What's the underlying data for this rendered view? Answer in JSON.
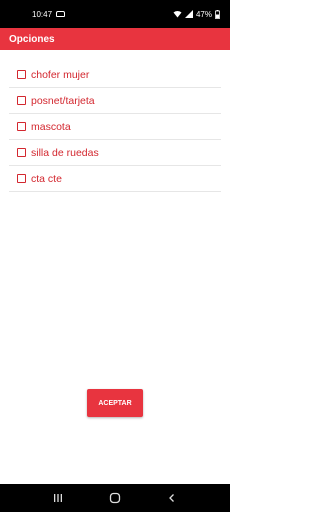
{
  "status_bar": {
    "time": "10:47",
    "battery": "47%"
  },
  "app_bar": {
    "title": "Opciones"
  },
  "options": [
    {
      "label": "chofer mujer",
      "checked": false
    },
    {
      "label": "posnet/tarjeta",
      "checked": false
    },
    {
      "label": "mascota",
      "checked": false
    },
    {
      "label": "silla de ruedas",
      "checked": false
    },
    {
      "label": "cta cte",
      "checked": false
    }
  ],
  "accept_button": {
    "label": "ACEPTAR"
  },
  "colors": {
    "accent": "#e8343f",
    "option_text": "#d3272f"
  },
  "icons": {
    "status_left": "car-icon",
    "status_right": [
      "wifi-icon",
      "signal-icon",
      "battery-icon"
    ],
    "nav": [
      "recent-apps-icon",
      "home-icon",
      "back-icon"
    ]
  }
}
